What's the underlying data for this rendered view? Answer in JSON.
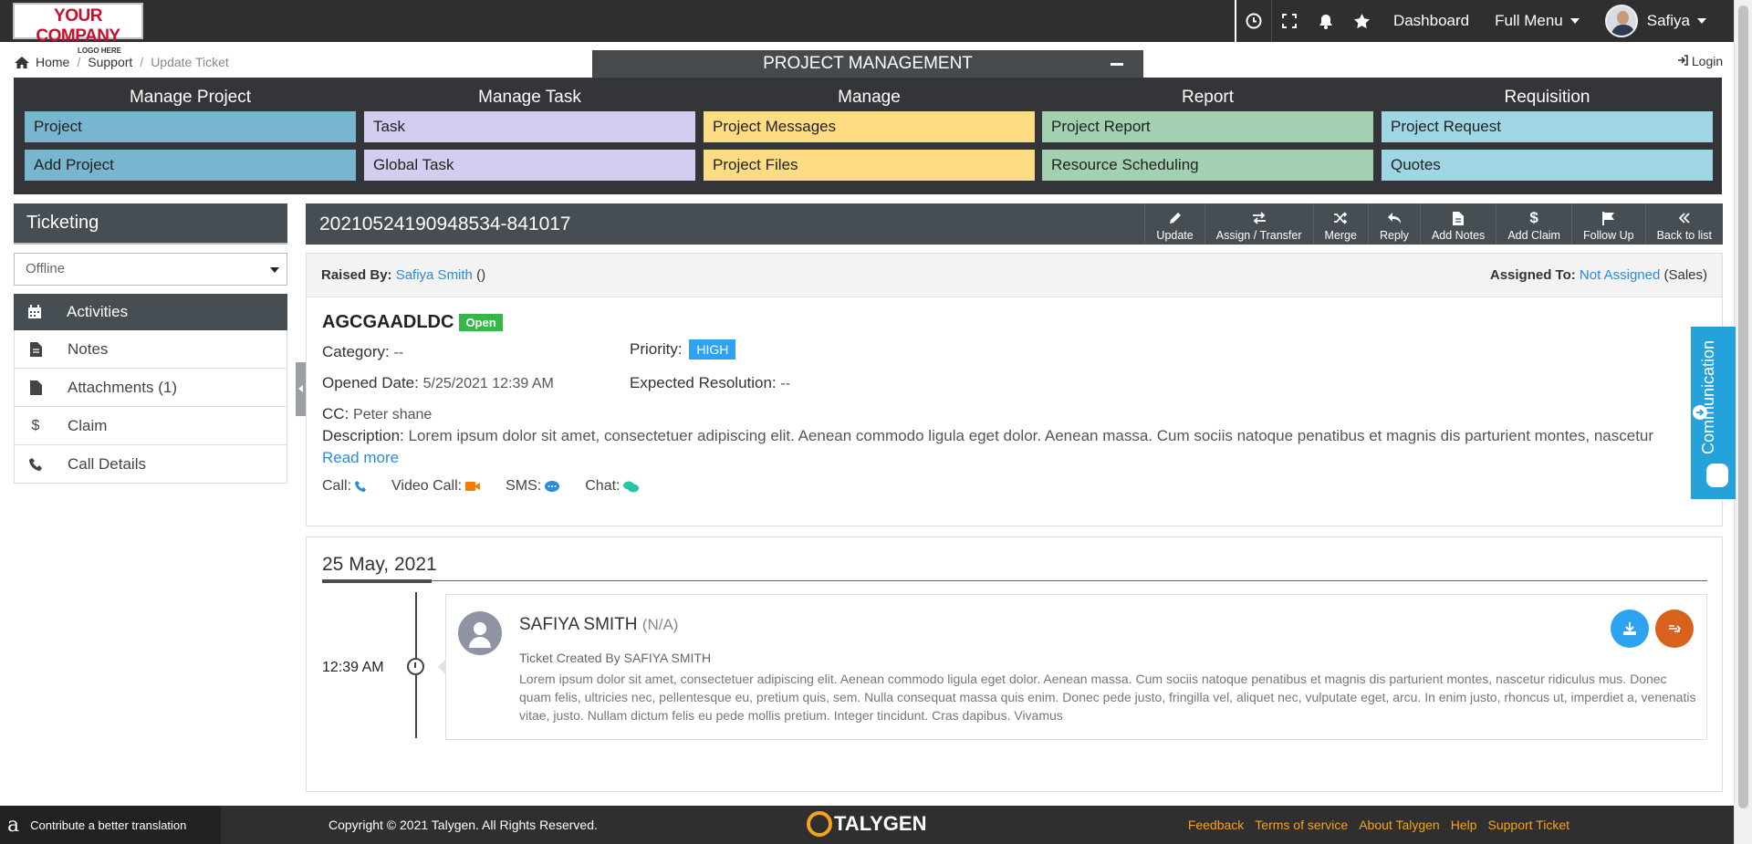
{
  "topbar": {
    "logo_line1": "YOUR COMPANY",
    "logo_line2": "LOGO HERE",
    "dashboard": "Dashboard",
    "full_menu": "Full Menu",
    "user": "Safiya"
  },
  "breadcrumb": {
    "home": "Home",
    "support": "Support",
    "current": "Update Ticket"
  },
  "login": "Login",
  "pm": {
    "title": "PROJECT MANAGEMENT",
    "columns": [
      {
        "header": "Manage Project",
        "items": [
          "Project",
          "Add Project"
        ],
        "color": "#78b6cf"
      },
      {
        "header": "Manage Task",
        "items": [
          "Task",
          "Global Task"
        ],
        "color": "#d3cdf0"
      },
      {
        "header": "Manage",
        "items": [
          "Project Messages",
          "Project Files"
        ],
        "color": "#fedc84"
      },
      {
        "header": "Report",
        "items": [
          "Project Report",
          "Resource Scheduling"
        ],
        "color": "#a2d0b1"
      },
      {
        "header": "Requisition",
        "items": [
          "Project Request",
          "Quotes"
        ],
        "color": "#9fd6e3"
      }
    ]
  },
  "sidebar": {
    "title": "Ticketing",
    "status": "Offline",
    "items": [
      {
        "label": "Activities",
        "icon": "calendar-icon"
      },
      {
        "label": "Notes",
        "icon": "file-icon"
      },
      {
        "label": "Attachments (1)",
        "icon": "file-icon"
      },
      {
        "label": "Claim",
        "icon": "dollar-icon"
      },
      {
        "label": "Call Details",
        "icon": "phone-icon"
      }
    ]
  },
  "ticket": {
    "id": "20210524190948534-841017",
    "actions": [
      "Update",
      "Assign / Transfer",
      "Merge",
      "Reply",
      "Add Notes",
      "Add Claim",
      "Follow Up",
      "Back to list"
    ],
    "raised_by_label": "Raised By:",
    "raised_by": "Safiya Smith",
    "raised_by_suffix": "()",
    "assigned_to_label": "Assigned To:",
    "assigned_to": "Not Assigned",
    "assigned_to_suffix": "(Sales)",
    "title": "AGCGAADLDC",
    "status": "Open",
    "category_label": "Category:",
    "category": "--",
    "priority_label": "Priority:",
    "priority": "HIGH",
    "opened_label": "Opened Date:",
    "opened": "5/25/2021 12:39 AM",
    "expected_label": "Expected Resolution:",
    "expected": "--",
    "cc_label": "CC:",
    "cc": "Peter shane",
    "desc_label": "Description:",
    "description": "Lorem ipsum dolor sit amet, consectetuer adipiscing elit. Aenean commodo ligula eget dolor. Aenean massa. Cum sociis natoque penatibus et magnis dis parturient montes, nascetur",
    "read_more": "Read more",
    "call": "Call:",
    "video_call": "Video Call:",
    "sms": "SMS:",
    "chat": "Chat:"
  },
  "communication": "Communication",
  "timeline": {
    "date": "25 May, 2021",
    "time": "12:39 AM",
    "name": "SAFIYA SMITH",
    "name_suffix": "(N/A)",
    "subtitle": "Ticket Created By SAFIYA SMITH",
    "text": "Lorem ipsum dolor sit amet, consectetuer adipiscing elit. Aenean commodo ligula eget dolor. Aenean massa. Cum sociis natoque penatibus et magnis dis parturient montes, nascetur ridiculus mus. Donec quam felis, ultricies nec, pellentesque eu, pretium quis, sem. Nulla consequat massa quis enim. Donec pede justo, fringilla vel, aliquet nec, vulputate eget, arcu. In enim justo, rhoncus ut, imperdiet a, venenatis vitae, justo. Nullam dictum felis eu pede mollis pretium. Integer tincidunt. Cras dapibus. Vivamus"
  },
  "footer": {
    "translate": "Contribute a better translation",
    "copyright": "Copyright © 2021 Talygen. All Rights Reserved.",
    "brand": "TALYGEN",
    "links": [
      "Feedback",
      "Terms of service",
      "About Talygen",
      "Help",
      "Support Ticket"
    ]
  }
}
